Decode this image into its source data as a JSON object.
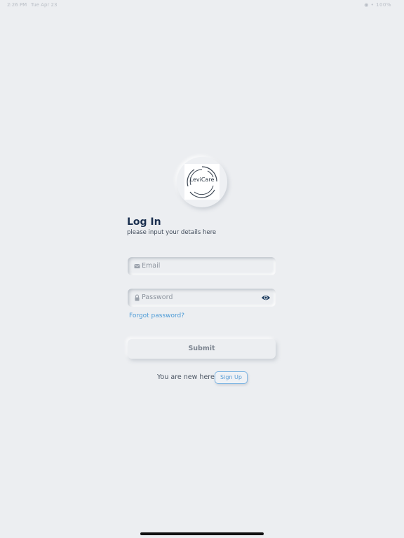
{
  "status_bar": {
    "time": "2:26 PM",
    "date": "Tue Apr 23",
    "indicators": "◉ • 100%"
  },
  "logo": {
    "text": "LeviCare"
  },
  "login": {
    "title": "Log In",
    "subtitle": "please input your details here",
    "email_placeholder": "Email",
    "password_placeholder": "Password",
    "forgot_label": "Forgot password?",
    "submit_label": "Submit",
    "new_here_text": "You are new here?",
    "signup_label": "Sign Up"
  },
  "icons": {
    "email": "envelope-icon",
    "password": "lock-icon",
    "show_password": "eye-icon"
  },
  "colors": {
    "background": "#eceef1",
    "title": "#1a2f4f",
    "link": "#4b9ad6",
    "eye": "#1c3b5e"
  }
}
